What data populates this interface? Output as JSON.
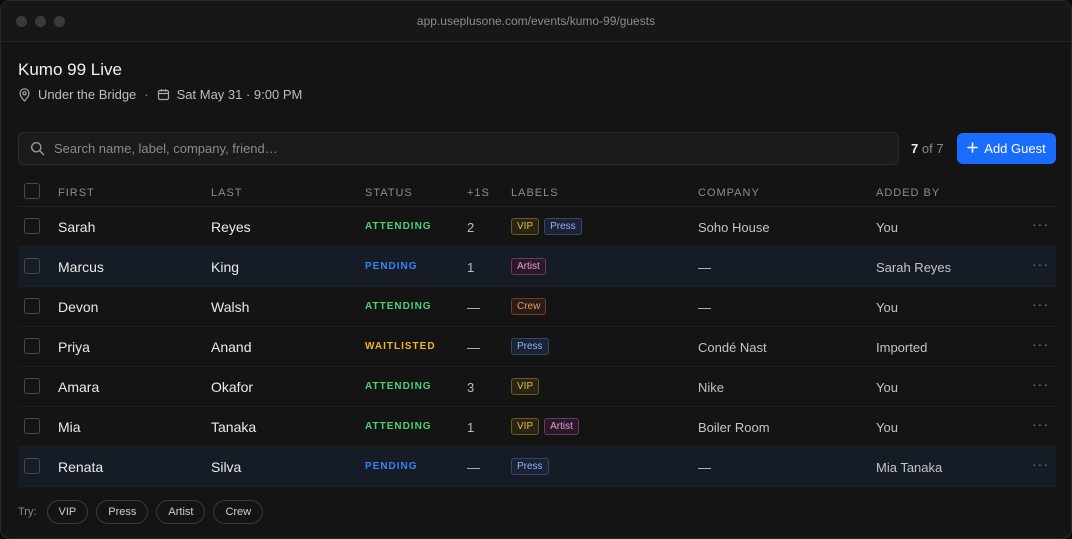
{
  "browser": {
    "url": "app.useplusone.com/events/kumo-99/guests"
  },
  "event": {
    "title": "Kumo 99 Live",
    "venue": "Under the Bridge",
    "date": "Sat May 31 · 9:00 PM"
  },
  "search": {
    "placeholder": "Search name, label, company, friend…"
  },
  "count": {
    "shown": "7",
    "of_text": "of 7"
  },
  "add_guest_label": "Add Guest",
  "columns": [
    "FIRST",
    "LAST",
    "STATUS",
    "+1S",
    "LABELS",
    "COMPANY",
    "ADDED BY"
  ],
  "status_colors": {
    "ATTENDING": "#4ad17a",
    "PENDING": "#3b82f6",
    "WAITLISTED": "#f0b429"
  },
  "rows": [
    {
      "first": "Sarah",
      "last": "Reyes",
      "status": "ATTENDING",
      "plus": "2",
      "labels": [
        "VIP",
        "Press"
      ],
      "company": "Soho House",
      "added_by": "You"
    },
    {
      "first": "Marcus",
      "last": "King",
      "status": "PENDING",
      "plus": "1",
      "labels": [
        "Artist"
      ],
      "company": "—",
      "added_by": "Sarah Reyes"
    },
    {
      "first": "Devon",
      "last": "Walsh",
      "status": "ATTENDING",
      "plus": "—",
      "labels": [
        "Crew"
      ],
      "company": "—",
      "added_by": "You"
    },
    {
      "first": "Priya",
      "last": "Anand",
      "status": "WAITLISTED",
      "plus": "—",
      "labels": [
        "Press"
      ],
      "company": "Condé Nast",
      "added_by": "Imported"
    },
    {
      "first": "Amara",
      "last": "Okafor",
      "status": "ATTENDING",
      "plus": "3",
      "labels": [
        "VIP"
      ],
      "company": "Nike",
      "added_by": "You"
    },
    {
      "first": "Mia",
      "last": "Tanaka",
      "status": "ATTENDING",
      "plus": "1",
      "labels": [
        "VIP",
        "Artist"
      ],
      "company": "Boiler Room",
      "added_by": "You"
    },
    {
      "first": "Renata",
      "last": "Silva",
      "status": "PENDING",
      "plus": "—",
      "labels": [
        "Press"
      ],
      "company": "—",
      "added_by": "Mia Tanaka"
    }
  ],
  "highlighted_rows": [
    1,
    6
  ],
  "more_glyph": "···",
  "try": {
    "label": "Try:",
    "chips": [
      "VIP",
      "Press",
      "Artist",
      "Crew"
    ]
  }
}
